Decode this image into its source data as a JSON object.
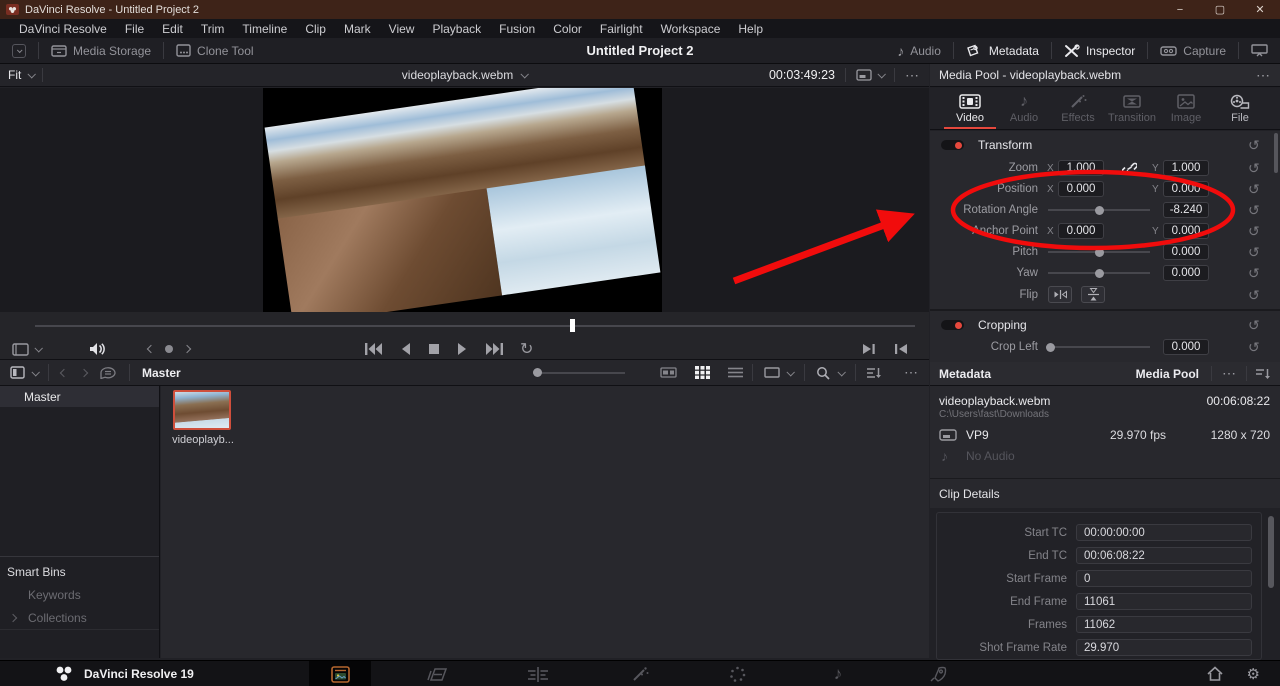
{
  "window": {
    "title": "DaVinci Resolve - Untitled Project 2"
  },
  "menu": {
    "items": [
      "DaVinci Resolve",
      "File",
      "Edit",
      "Trim",
      "Timeline",
      "Clip",
      "Mark",
      "View",
      "Playback",
      "Fusion",
      "Color",
      "Fairlight",
      "Workspace",
      "Help"
    ]
  },
  "toolbar": {
    "media_storage": "Media Storage",
    "clone_tool": "Clone Tool",
    "project_title": "Untitled Project 2",
    "audio": "Audio",
    "metadata": "Metadata",
    "inspector": "Inspector",
    "capture": "Capture"
  },
  "viewer": {
    "zoom_mode": "Fit",
    "clip_name": "videoplayback.webm",
    "timecode": "00:03:49:23"
  },
  "inspector": {
    "header": "Media Pool - videoplayback.webm",
    "tabs": {
      "video": "Video",
      "audio": "Audio",
      "effects": "Effects",
      "transition": "Transition",
      "image": "Image",
      "file": "File"
    },
    "transform": {
      "title": "Transform",
      "zoom": {
        "label": "Zoom",
        "x_label": "X",
        "x": "1.000",
        "y_label": "Y",
        "y": "1.000"
      },
      "position": {
        "label": "Position",
        "x_label": "X",
        "x": "0.000",
        "y_label": "Y",
        "y": "0.000"
      },
      "rotation": {
        "label": "Rotation Angle",
        "value": "-8.240"
      },
      "anchor": {
        "label": "Anchor Point",
        "x_label": "X",
        "x": "0.000",
        "y_label": "Y",
        "y": "0.000"
      },
      "pitch": {
        "label": "Pitch",
        "value": "0.000"
      },
      "yaw": {
        "label": "Yaw",
        "value": "0.000"
      },
      "flip": {
        "label": "Flip"
      }
    },
    "cropping": {
      "title": "Cropping",
      "crop_left": {
        "label": "Crop Left",
        "value": "0.000"
      }
    }
  },
  "metadata_panel": {
    "title": "Metadata",
    "context_label": "Media Pool",
    "filename": "videoplayback.webm",
    "duration": "00:06:08:22",
    "file_path": "C:\\Users\\fast\\Downloads",
    "codec": "VP9",
    "frame_rate": "29.970 fps",
    "resolution": "1280 x 720",
    "audio_status": "No Audio"
  },
  "clip_details": {
    "title": "Clip Details",
    "start_tc": {
      "label": "Start TC",
      "value": "00:00:00:00"
    },
    "end_tc": {
      "label": "End TC",
      "value": "00:06:08:22"
    },
    "start_frame": {
      "label": "Start Frame",
      "value": "0"
    },
    "end_frame": {
      "label": "End Frame",
      "value": "11061"
    },
    "frames": {
      "label": "Frames",
      "value": "11062"
    },
    "shot_frame_rate": {
      "label": "Shot Frame Rate",
      "value": "29.970"
    }
  },
  "media_pool": {
    "bin_breadcrumb": "Master",
    "bin_name": "Master",
    "clip_label": "videoplayb...",
    "smart_bins_title": "Smart Bins",
    "keywords": "Keywords",
    "collections": "Collections"
  },
  "bottom_bar": {
    "app_label": "DaVinci Resolve 19"
  },
  "icons": {
    "more": "⋯",
    "minimize": "−",
    "maximize": "▢",
    "close": "✕",
    "reset": "↺",
    "loop": "↻",
    "note": "♪",
    "gear": "⚙",
    "check": "✓"
  },
  "colors": {
    "accent_red": "#e5483d",
    "annotation_red": "#f10c0c",
    "selection_orange": "#cf4f3c"
  }
}
